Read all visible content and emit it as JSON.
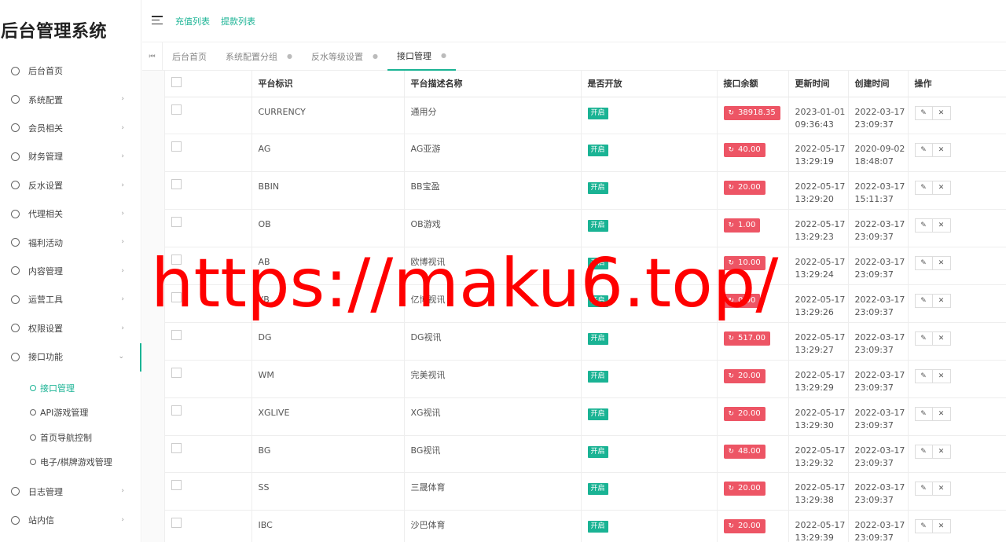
{
  "brand": "后台管理系统",
  "sidebar": {
    "items": [
      {
        "label": "后台首页",
        "arrow": ""
      },
      {
        "label": "系统配置",
        "arrow": "›"
      },
      {
        "label": "会员相关",
        "arrow": "›"
      },
      {
        "label": "财务管理",
        "arrow": "›"
      },
      {
        "label": "反水设置",
        "arrow": "›"
      },
      {
        "label": "代理相关",
        "arrow": "›"
      },
      {
        "label": "福利活动",
        "arrow": "›"
      },
      {
        "label": "内容管理",
        "arrow": "›"
      },
      {
        "label": "运营工具",
        "arrow": "›"
      },
      {
        "label": "权限设置",
        "arrow": "›"
      },
      {
        "label": "接口功能",
        "arrow": "⌄"
      }
    ],
    "subitems": [
      {
        "label": "接口管理",
        "active": true
      },
      {
        "label": "API游戏管理",
        "active": false
      },
      {
        "label": "首页导航控制",
        "active": false
      },
      {
        "label": "电子/棋牌游戏管理",
        "active": false
      }
    ],
    "items_after": [
      {
        "label": "日志管理",
        "arrow": "›"
      },
      {
        "label": "站内信",
        "arrow": "›"
      }
    ]
  },
  "topbar": {
    "links": [
      "充值列表",
      "提款列表"
    ]
  },
  "tabs": {
    "nav": "⏮",
    "items": [
      {
        "label": "后台首页",
        "closable": false,
        "active": false
      },
      {
        "label": "系统配置分组",
        "closable": true,
        "active": false
      },
      {
        "label": "反水等级设置",
        "closable": true,
        "active": false
      },
      {
        "label": "接口管理",
        "closable": true,
        "active": true
      }
    ],
    "close_glyph": "●"
  },
  "table": {
    "headers": [
      "",
      "平台标识",
      "平台描述名称",
      "是否开放",
      "接口余额",
      "更新时间",
      "创建时间",
      "操作"
    ],
    "open_label": "开启",
    "refresh_glyph": "↻",
    "edit_glyph": "✎",
    "delete_glyph": "✕",
    "rows": [
      {
        "code": "CURRENCY",
        "name": "通用分",
        "balance": "38918.35",
        "updated": [
          "2023-01-01",
          "09:36:43"
        ],
        "created": [
          "2022-03-17",
          "23:09:37"
        ]
      },
      {
        "code": "AG",
        "name": "AG亚游",
        "balance": "40.00",
        "updated": [
          "2022-05-17",
          "13:29:19"
        ],
        "created": [
          "2020-09-02",
          "18:48:07"
        ]
      },
      {
        "code": "BBIN",
        "name": "BB宝盈",
        "balance": "20.00",
        "updated": [
          "2022-05-17",
          "13:29:20"
        ],
        "created": [
          "2022-03-17",
          "15:11:37"
        ]
      },
      {
        "code": "OB",
        "name": "OB游戏",
        "balance": "1.00",
        "updated": [
          "2022-05-17",
          "13:29:23"
        ],
        "created": [
          "2022-03-17",
          "23:09:37"
        ]
      },
      {
        "code": "AB",
        "name": "欧博视讯",
        "balance": "10.00",
        "updated": [
          "2022-05-17",
          "13:29:24"
        ],
        "created": [
          "2022-03-17",
          "23:09:37"
        ]
      },
      {
        "code": "YB",
        "name": "亿博视讯",
        "balance": "0.00",
        "updated": [
          "2022-05-17",
          "13:29:26"
        ],
        "created": [
          "2022-03-17",
          "23:09:37"
        ]
      },
      {
        "code": "DG",
        "name": "DG视讯",
        "balance": "517.00",
        "updated": [
          "2022-05-17",
          "13:29:27"
        ],
        "created": [
          "2022-03-17",
          "23:09:37"
        ]
      },
      {
        "code": "WM",
        "name": "完美视讯",
        "balance": "20.00",
        "updated": [
          "2022-05-17",
          "13:29:29"
        ],
        "created": [
          "2022-03-17",
          "23:09:37"
        ]
      },
      {
        "code": "XGLIVE",
        "name": "XG视讯",
        "balance": "20.00",
        "updated": [
          "2022-05-17",
          "13:29:30"
        ],
        "created": [
          "2022-03-17",
          "23:09:37"
        ]
      },
      {
        "code": "BG",
        "name": "BG视讯",
        "balance": "48.00",
        "updated": [
          "2022-05-17",
          "13:29:32"
        ],
        "created": [
          "2022-03-17",
          "23:09:37"
        ]
      },
      {
        "code": "SS",
        "name": "三晟体育",
        "balance": "20.00",
        "updated": [
          "2022-05-17",
          "13:29:38"
        ],
        "created": [
          "2022-03-17",
          "23:09:37"
        ]
      },
      {
        "code": "IBC",
        "name": "沙巴体育",
        "balance": "20.00",
        "updated": [
          "2022-05-17",
          "13:29:39"
        ],
        "created": [
          "2022-03-17",
          "23:09:37"
        ]
      }
    ]
  },
  "watermark": "https://maku6.top/",
  "colors": {
    "accent": "#1ab394",
    "danger": "#ed5565",
    "watermark": "#ff0000"
  }
}
